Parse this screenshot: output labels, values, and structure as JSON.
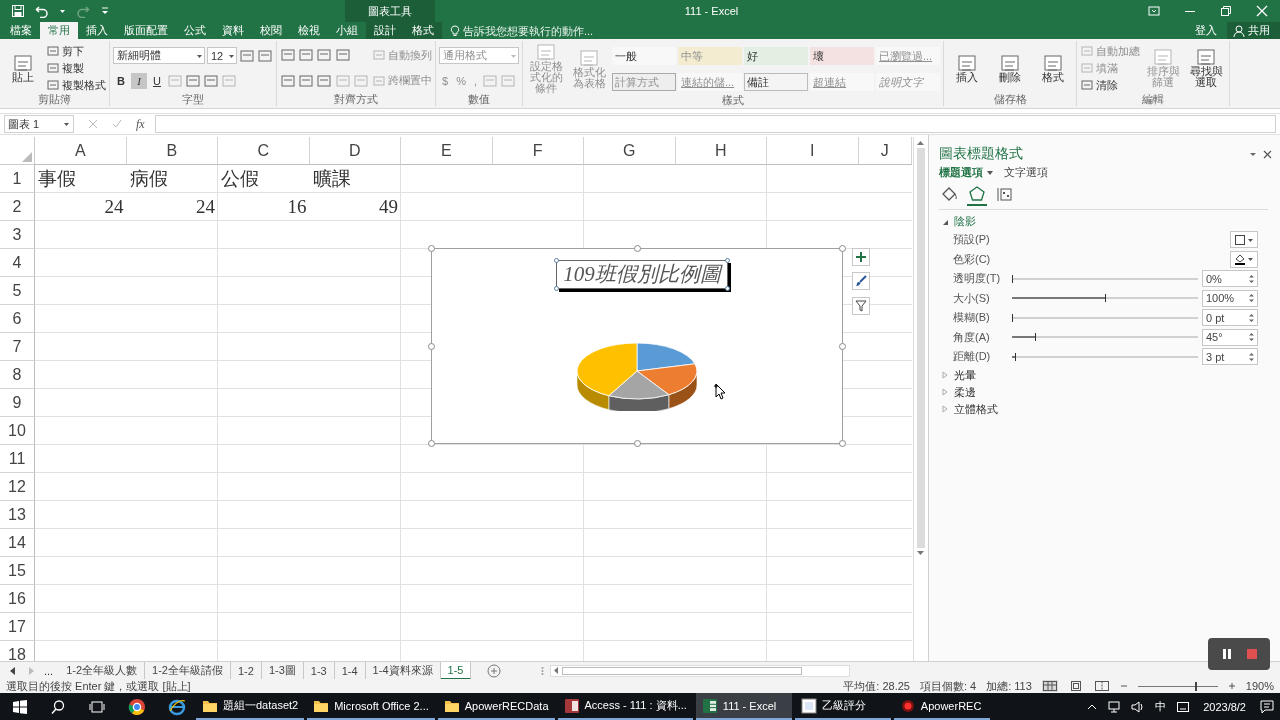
{
  "window": {
    "title": "111 - Excel",
    "tool_context": "圖表工具"
  },
  "ribbon_tabs": [
    {
      "label": "檔案",
      "selected": false,
      "contextual": false
    },
    {
      "label": "常用",
      "selected": true,
      "contextual": false
    },
    {
      "label": "插入",
      "selected": false,
      "contextual": false
    },
    {
      "label": "版面配置",
      "selected": false,
      "contextual": false
    },
    {
      "label": "公式",
      "selected": false,
      "contextual": false
    },
    {
      "label": "資料",
      "selected": false,
      "contextual": false
    },
    {
      "label": "校閱",
      "selected": false,
      "contextual": false
    },
    {
      "label": "檢視",
      "selected": false,
      "contextual": false
    },
    {
      "label": "小組",
      "selected": false,
      "contextual": false
    },
    {
      "label": "設計",
      "selected": false,
      "contextual": true
    },
    {
      "label": "格式",
      "selected": false,
      "contextual": true
    }
  ],
  "tell_me": {
    "placeholder": "告訴我您想要執行的動作..."
  },
  "account": {
    "sign_in": "登入",
    "share": "共用"
  },
  "ribbon_groups": [
    {
      "label": "剪貼簿",
      "columns": [
        [
          [
            {
              "kind": "large",
              "label": "貼上",
              "disabled": false
            }
          ]
        ],
        [
          [
            {
              "kind": "small",
              "label": "剪下",
              "disabled": false
            }
          ],
          [
            {
              "kind": "small",
              "label": "複製",
              "disabled": false
            }
          ],
          [
            {
              "kind": "small",
              "label": "複製格式",
              "disabled": false
            }
          ]
        ]
      ]
    },
    {
      "label": "字型",
      "columns": [
        [
          [
            {
              "kind": "font_field",
              "value": "新細明體",
              "disabled": false
            },
            {
              "kind": "size_field",
              "value": "12",
              "disabled": false
            },
            {
              "kind": "icon",
              "disabled": false
            },
            {
              "kind": "icon",
              "disabled": false
            }
          ],
          [
            {
              "kind": "format",
              "label": "B",
              "selected": false,
              "disabled": false
            },
            {
              "kind": "format",
              "label": "I",
              "selected": true,
              "disabled": false
            },
            {
              "kind": "format",
              "label": "U",
              "selected": false,
              "disabled": false
            },
            {
              "kind": "icon",
              "disabled": true
            },
            {
              "kind": "icon",
              "disabled": false
            },
            {
              "kind": "icon",
              "disabled": false
            },
            {
              "kind": "icon",
              "disabled": true
            }
          ]
        ]
      ]
    },
    {
      "label": "對齊方式",
      "columns": [
        [
          [
            {
              "kind": "icon",
              "disabled": false
            },
            {
              "kind": "icon",
              "disabled": false
            },
            {
              "kind": "icon",
              "disabled": false
            }
          ],
          [
            {
              "kind": "icon",
              "disabled": false
            },
            {
              "kind": "icon",
              "disabled": false
            },
            {
              "kind": "icon",
              "disabled": false
            }
          ]
        ],
        [
          [
            {
              "kind": "icon",
              "disabled": false
            }
          ],
          [
            {
              "kind": "icon",
              "disabled": true
            },
            {
              "kind": "icon",
              "disabled": true
            }
          ]
        ],
        [
          [
            {
              "kind": "small",
              "label": "自動換列",
              "disabled": true
            }
          ],
          [
            {
              "kind": "small",
              "label": "跨欄置中",
              "disabled": true
            }
          ]
        ]
      ]
    },
    {
      "label": "數值",
      "columns": [
        [
          [
            {
              "kind": "number_field",
              "value": "通用格式",
              "disabled": true
            }
          ],
          [
            {
              "kind": "symbol",
              "label": "$",
              "disabled": true
            },
            {
              "kind": "symbol",
              "label": "%",
              "disabled": true
            },
            {
              "kind": "symbol",
              "label": ",",
              "disabled": true
            },
            {
              "kind": "icon",
              "disabled": true
            },
            {
              "kind": "icon",
              "disabled": true
            }
          ]
        ]
      ]
    },
    {
      "label": "樣式",
      "columns": [
        [
          [
            {
              "kind": "large",
              "label": "設定格式化的條件",
              "disabled": true
            }
          ]
        ],
        [
          [
            {
              "kind": "large",
              "label": "格式化為表格",
              "disabled": true
            }
          ]
        ],
        [
          [
            {
              "kind": "style",
              "label": "一般",
              "disabled": false
            },
            {
              "kind": "style",
              "label": "中等",
              "disabled": true
            },
            {
              "kind": "style",
              "label": "好",
              "disabled": false
            },
            {
              "kind": "style",
              "label": "壞",
              "disabled": false
            },
            {
              "kind": "style",
              "label": "已瀏覽過...",
              "disabled": true
            }
          ],
          [
            {
              "kind": "style",
              "label": "計算方式",
              "disabled": true
            },
            {
              "kind": "style",
              "label": "連結的儲...",
              "disabled": true
            },
            {
              "kind": "style",
              "label": "備註",
              "disabled": false
            },
            {
              "kind": "style",
              "label": "超連結",
              "disabled": true
            },
            {
              "kind": "style",
              "label": "說明文字",
              "disabled": true
            }
          ]
        ]
      ]
    },
    {
      "label": "儲存格",
      "columns": [
        [
          [
            {
              "kind": "large",
              "label": "插入",
              "disabled": false
            }
          ]
        ],
        [
          [
            {
              "kind": "large",
              "label": "刪除",
              "disabled": false
            }
          ]
        ],
        [
          [
            {
              "kind": "large",
              "label": "格式",
              "disabled": false
            }
          ]
        ]
      ]
    },
    {
      "label": "編輯",
      "columns": [
        [
          [
            {
              "kind": "small",
              "label": "自動加總",
              "disabled": true
            }
          ],
          [
            {
              "kind": "small",
              "label": "填滿",
              "disabled": true
            }
          ],
          [
            {
              "kind": "small",
              "label": "清除",
              "disabled": false
            }
          ]
        ],
        [
          [
            {
              "kind": "large",
              "label": "排序與篩選",
              "disabled": true
            }
          ]
        ],
        [
          [
            {
              "kind": "large",
              "label": "尋找與選取",
              "disabled": false
            }
          ]
        ]
      ]
    }
  ],
  "formula_bar": {
    "name_box": "圖表 1",
    "function_label": "fx"
  },
  "sheet": {
    "columns": [
      "A",
      "B",
      "C",
      "D",
      "E",
      "F",
      "G",
      "H",
      "I",
      "J"
    ],
    "rows": [
      {
        "header": "1",
        "cells": [
          {
            "text": "事假"
          },
          {
            "text": "病假"
          },
          {
            "text": "公假"
          },
          {
            "text": "曠課"
          }
        ]
      },
      {
        "header": "2",
        "cells": [
          {
            "number": "24"
          },
          {
            "number": "24"
          },
          {
            "number": "16"
          },
          {
            "number": "49"
          }
        ]
      },
      {
        "header": "3"
      },
      {
        "header": "4"
      },
      {
        "header": "5"
      },
      {
        "header": "6"
      },
      {
        "header": "7"
      },
      {
        "header": "8"
      },
      {
        "header": "9"
      },
      {
        "header": "10"
      },
      {
        "header": "11"
      },
      {
        "header": "12"
      },
      {
        "header": "13"
      },
      {
        "header": "14"
      },
      {
        "header": "15"
      },
      {
        "header": "16"
      },
      {
        "header": "17"
      },
      {
        "header": "18"
      }
    ]
  },
  "chart": {
    "title": "109班假別比例圖",
    "selected": true,
    "title_selected": true
  },
  "pane": {
    "title": "圖表標題格式",
    "tabs": [
      {
        "label": "標題選項",
        "selected": true
      },
      {
        "label": "文字選項",
        "selected": false
      }
    ],
    "category_icons": [
      {
        "selected": false
      },
      {
        "selected": true
      },
      {
        "selected": false
      }
    ],
    "sections": [
      {
        "label": "陰影",
        "expanded": true,
        "rows": [
          {
            "kind": "preset",
            "label": "預設(P)"
          },
          {
            "kind": "color",
            "label": "色彩(C)"
          },
          {
            "kind": "slider",
            "label": "透明度(T)",
            "level": 0,
            "value": "0%"
          },
          {
            "kind": "slider",
            "label": "大小(S)",
            "level": 0.5,
            "value": "100%"
          },
          {
            "kind": "slider",
            "label": "模糊(B)",
            "level": 0,
            "value": "0 pt"
          },
          {
            "kind": "slider",
            "label": "角度(A)",
            "level": 0.125,
            "value": "45°"
          },
          {
            "kind": "slider",
            "label": "距離(D)",
            "level": 0.015,
            "value": "3 pt"
          }
        ]
      },
      {
        "label": "光暈",
        "expanded": false
      },
      {
        "label": "柔邊",
        "expanded": false
      },
      {
        "label": "立體格式",
        "expanded": false
      }
    ]
  },
  "sheet_tabs": {
    "more": "...",
    "tabs": [
      {
        "label": "1-2全年級人數",
        "selected": false
      },
      {
        "label": "1-2全年級請假",
        "selected": false
      },
      {
        "label": "1-2",
        "selected": false
      },
      {
        "label": "1-3圖",
        "selected": false
      },
      {
        "label": "1-3",
        "selected": false
      },
      {
        "label": "1-4",
        "selected": false
      },
      {
        "label": "1-4資料來源",
        "selected": false
      },
      {
        "label": "1-5",
        "selected": true
      }
    ]
  },
  "status_bar": {
    "message": "選取目的後按 Enter 鍵，或選取 [貼上]",
    "average": "平均值: 28.25",
    "count": "項目個數: 4",
    "sum": "加總: 113",
    "zoom_slider": {
      "level": 0.72
    },
    "zoom": "190%"
  },
  "taskbar": {
    "apps": [
      {
        "kind": "folder",
        "label": "題組一dataset2",
        "active": false
      },
      {
        "kind": "folder",
        "label": "Microsoft Office 2...",
        "active": false
      },
      {
        "kind": "folder",
        "label": "ApowerRECData",
        "active": false
      },
      {
        "kind": "database",
        "label": "Access - 111 : 資料...",
        "active": false
      },
      {
        "kind": "spreadsheet",
        "label": "111 - Excel",
        "active": true
      },
      {
        "kind": "grader",
        "label": "乙級評分",
        "active": false
      },
      {
        "kind": "recorder",
        "label": "ApowerREC",
        "active": false
      }
    ],
    "input_method": "中",
    "date": "2023/8/2"
  }
}
